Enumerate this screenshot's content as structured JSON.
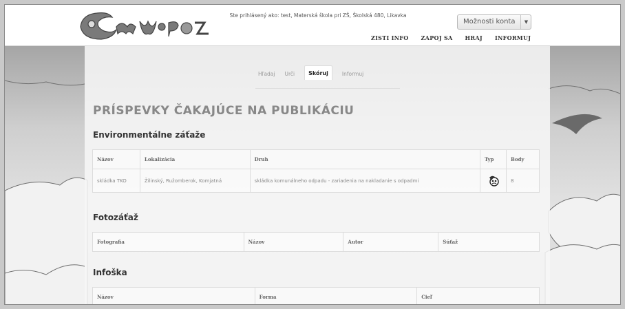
{
  "header": {
    "logo_text": "Enviróza",
    "login_info": "Ste prihlásený ako: test, Materská škola pri ZŠ, Školská 480, Likavka",
    "account_button": "Možnosti konta",
    "nav": [
      "ZISTI INFO",
      "ZAPOJ SA",
      "HRAJ",
      "INFORMUJ"
    ]
  },
  "subtabs": [
    "Hľadaj",
    "Urči",
    "Skóruj",
    "Informuj"
  ],
  "active_subtab": "Skóruj",
  "page_title": "PRÍSPEVKY ČAKAJÚCE NA PUBLIKÁCIU",
  "sections": {
    "environmental": {
      "title": "Environmentálne záťaže",
      "columns": [
        "Názov",
        "Lokalizácia",
        "Druh",
        "Typ",
        "Body"
      ],
      "rows": [
        {
          "nazov": "skládka TKO",
          "lokalizacia": "Žilinský, Ružomberok, Komjatná",
          "druh": "skládka komunálneho odpadu - zariadenia na nakladanie s odpadmi",
          "typ_icon": "pollution-type-icon",
          "body": "8"
        }
      ]
    },
    "photo": {
      "title": "Fotozáťaž",
      "columns": [
        "Fotografia",
        "Názov",
        "Autor",
        "Súťaž"
      ]
    },
    "infoska": {
      "title": "Infoška",
      "columns": [
        "Názov",
        "Forma",
        "Cieľ"
      ]
    }
  },
  "colors": {
    "header_bg": "#ffffff",
    "panel_bg": "#f7f7f7",
    "title": "#888888"
  }
}
